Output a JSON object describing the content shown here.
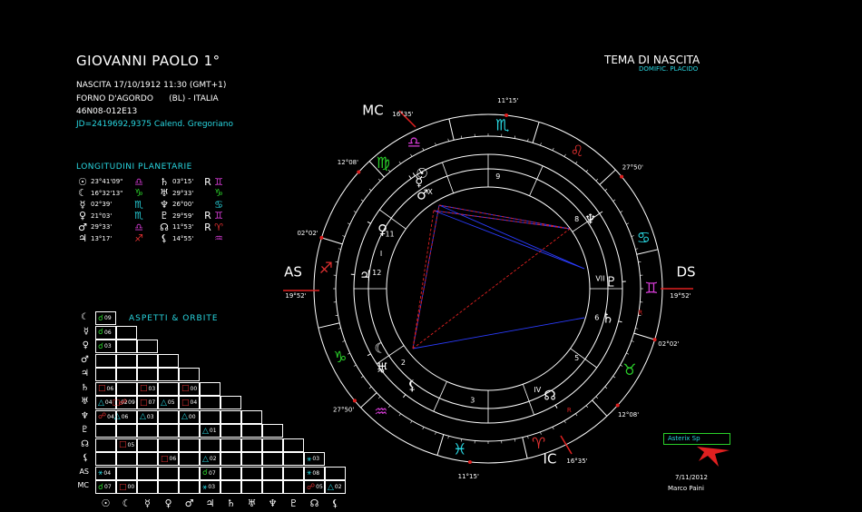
{
  "header": {
    "name": "GIOVANNI PAOLO 1°",
    "birth": "NASCITA 17/10/1912 11:30 (GMT+1)",
    "place": "FORNO D'AGORDO      (BL) - ITALIA",
    "coords": "46N08-012E13",
    "jd": "JD=2419692,9375  Calend. Gregoriano"
  },
  "chart_header": {
    "title": "TEMA DI NASCITA",
    "subtitle": "DOMIFIC. PLACIDO"
  },
  "longitudes": {
    "title": "LONGITUDINI PLANETARIE",
    "rows": [
      [
        {
          "g": "☉",
          "c": "#fff",
          "v": "23°41'09\""
        },
        {
          "g": "♎",
          "c": "#d43bd4",
          "v": ""
        },
        {
          "g": "♄",
          "c": "#fff",
          "v": "03°15'"
        },
        {
          "g": "R",
          "c": "#fff",
          "v": ""
        },
        {
          "g": "♊",
          "c": "#d43bd4",
          "v": ""
        }
      ],
      [
        {
          "g": "☾",
          "c": "#fff",
          "v": "16°32'13\""
        },
        {
          "g": "♑",
          "c": "#2ad02a",
          "v": ""
        },
        {
          "g": "♅",
          "c": "#fff",
          "v": "29°33'"
        },
        {
          "g": "",
          "c": "#fff",
          "v": ""
        },
        {
          "g": "♑",
          "c": "#2ad02a",
          "v": ""
        }
      ],
      [
        {
          "g": "☿",
          "c": "#fff",
          "v": "02°39'"
        },
        {
          "g": "♏",
          "c": "#29d6e0",
          "v": ""
        },
        {
          "g": "♆",
          "c": "#fff",
          "v": "26°00'"
        },
        {
          "g": "",
          "c": "#fff",
          "v": ""
        },
        {
          "g": "♋",
          "c": "#29d6e0",
          "v": ""
        }
      ],
      [
        {
          "g": "♀",
          "c": "#fff",
          "v": "21°03'"
        },
        {
          "g": "♏",
          "c": "#29d6e0",
          "v": ""
        },
        {
          "g": "♇",
          "c": "#fff",
          "v": "29°59'"
        },
        {
          "g": "R",
          "c": "#fff",
          "v": ""
        },
        {
          "g": "♊",
          "c": "#d43bd4",
          "v": ""
        }
      ],
      [
        {
          "g": "♂",
          "c": "#fff",
          "v": "29°33'"
        },
        {
          "g": "♎",
          "c": "#d43bd4",
          "v": ""
        },
        {
          "g": "☊",
          "c": "#fff",
          "v": "11°53'"
        },
        {
          "g": "R",
          "c": "#fff",
          "v": ""
        },
        {
          "g": "♈",
          "c": "#e03030",
          "v": ""
        }
      ],
      [
        {
          "g": "♃",
          "c": "#fff",
          "v": "13°17'"
        },
        {
          "g": "♐",
          "c": "#e03030",
          "v": ""
        },
        {
          "g": "⚸",
          "c": "#fff",
          "v": "14°55'"
        },
        {
          "g": "",
          "c": "#fff",
          "v": ""
        },
        {
          "g": "♒",
          "c": "#d43bd4",
          "v": ""
        }
      ]
    ]
  },
  "aspects": {
    "title": "ASPETTI  &  ORBITE",
    "row_labels": [
      "☾",
      "☿",
      "♀",
      "♂",
      "♃",
      "♄",
      "♅",
      "♆",
      "♇",
      "☊",
      "⚸",
      "AS",
      "MC"
    ],
    "col_labels": [
      "☉",
      "☾",
      "☿",
      "♀",
      "♂",
      "♃",
      "♄",
      "♅",
      "♆",
      "♇",
      "☊",
      "⚸"
    ],
    "cells": [
      {
        "r": 0,
        "c": 0,
        "s": "☌",
        "sc": "#2ad02a",
        "v": "09"
      },
      {
        "r": 1,
        "c": 0,
        "s": "☌",
        "sc": "#2ad02a",
        "v": "06"
      },
      {
        "r": 1,
        "c": 2,
        "s": "☌",
        "sc": "#2ad02a",
        "v": "03"
      },
      {
        "r": 5,
        "c": 0,
        "s": "□",
        "sc": "#e03030",
        "v": "06"
      },
      {
        "r": 5,
        "c": 2,
        "s": "□",
        "sc": "#e03030",
        "v": "03"
      },
      {
        "r": 5,
        "c": 4,
        "s": "□",
        "sc": "#e03030",
        "v": "00"
      },
      {
        "r": 5,
        "c": 6,
        "s": "△",
        "sc": "#29d6e0",
        "v": "04"
      },
      {
        "r": 6,
        "c": 0,
        "s": "□",
        "sc": "#e03030",
        "v": "02"
      },
      {
        "r": 6,
        "c": 1,
        "s": "☍",
        "sc": "#e03030",
        "v": "09"
      },
      {
        "r": 6,
        "c": 2,
        "s": "□",
        "sc": "#e03030",
        "v": "07"
      },
      {
        "r": 6,
        "c": 3,
        "s": "△",
        "sc": "#29d6e0",
        "v": "05"
      },
      {
        "r": 6,
        "c": 4,
        "s": "□",
        "sc": "#e03030",
        "v": "04"
      },
      {
        "r": 6,
        "c": 7,
        "s": "☍",
        "sc": "#e03030",
        "v": "04"
      },
      {
        "r": 7,
        "c": 0,
        "s": "△",
        "sc": "#29d6e0",
        "v": "06"
      },
      {
        "r": 7,
        "c": 2,
        "s": "△",
        "sc": "#29d6e0",
        "v": "03"
      },
      {
        "r": 7,
        "c": 4,
        "s": "△",
        "sc": "#29d6e0",
        "v": "00"
      },
      {
        "r": 8,
        "c": 5,
        "s": "△",
        "sc": "#29d6e0",
        "v": "01"
      },
      {
        "r": 9,
        "c": 1,
        "s": "□",
        "sc": "#e03030",
        "v": "05"
      },
      {
        "r": 10,
        "c": 3,
        "s": "□",
        "sc": "#e03030",
        "v": "06"
      },
      {
        "r": 10,
        "c": 5,
        "s": "△",
        "sc": "#29d6e0",
        "v": "02"
      },
      {
        "r": 10,
        "c": 10,
        "s": "⚹",
        "sc": "#29d6e0",
        "v": "03"
      },
      {
        "r": 11,
        "c": 0,
        "s": "⚹",
        "sc": "#29d6e0",
        "v": "04"
      },
      {
        "r": 11,
        "c": 5,
        "s": "☌",
        "sc": "#2ad02a",
        "v": "07"
      },
      {
        "r": 11,
        "c": 10,
        "s": "⚹",
        "sc": "#29d6e0",
        "v": "08"
      },
      {
        "r": 12,
        "c": 0,
        "s": "☌",
        "sc": "#2ad02a",
        "v": "07"
      },
      {
        "r": 12,
        "c": 1,
        "s": "□",
        "sc": "#e03030",
        "v": "00"
      },
      {
        "r": 12,
        "c": 5,
        "s": "⚹",
        "sc": "#29d6e0",
        "v": "03"
      },
      {
        "r": 12,
        "c": 10,
        "s": "☍",
        "sc": "#e03030",
        "v": "05"
      },
      {
        "r": 12,
        "c": 11,
        "s": "△",
        "sc": "#29d6e0",
        "v": "02"
      }
    ]
  },
  "wheel": {
    "angles": {
      "mc": {
        "label": "MC",
        "deg": "16°35'"
      },
      "as": {
        "label": "AS",
        "deg": "19°52'"
      },
      "ds": {
        "label": "DS",
        "deg": "19°52'"
      },
      "ic": {
        "label": "IC",
        "deg": "16°35'"
      }
    },
    "cusp_degrees": [
      {
        "t": "11°15'",
        "a": -84
      },
      {
        "t": "27°50'",
        "a": -40
      },
      {
        "t": "02°02'",
        "a": 17
      },
      {
        "t": "12°08'",
        "a": 42
      },
      {
        "t": "11°15'",
        "a": 96
      },
      {
        "t": "27°50'",
        "a": 140
      },
      {
        "t": "02°02'",
        "a": 197
      },
      {
        "t": "12°08'",
        "a": 222
      }
    ],
    "signs": [
      {
        "g": "♎",
        "c": "#d43bd4",
        "a": -117
      },
      {
        "g": "♏",
        "c": "#29d6e0",
        "a": -85
      },
      {
        "g": "♌",
        "c": "#e03030",
        "a": -57
      },
      {
        "g": "♋",
        "c": "#29d6e0",
        "a": -18
      },
      {
        "g": "♊",
        "c": "#d43bd4",
        "a": 0
      },
      {
        "g": "♉",
        "c": "#2ad02a",
        "a": 30
      },
      {
        "g": "♈",
        "c": "#e03030",
        "a": 72
      },
      {
        "g": "♓",
        "c": "#29d6e0",
        "a": 100
      },
      {
        "g": "♒",
        "c": "#d43bd4",
        "a": 131
      },
      {
        "g": "♑",
        "c": "#2ad02a",
        "a": 155
      },
      {
        "g": "♐",
        "c": "#e03030",
        "a": 187
      },
      {
        "g": "♍",
        "c": "#2ad02a",
        "a": 230
      }
    ],
    "houses": [
      {
        "t": "I",
        "a": 198
      },
      {
        "t": "2",
        "a": 139
      },
      {
        "t": "3",
        "a": 98
      },
      {
        "t": "IV",
        "a": 64
      },
      {
        "t": "5",
        "a": 38
      },
      {
        "t": "6",
        "a": 15
      },
      {
        "t": "VII",
        "a": -5
      },
      {
        "t": "8",
        "a": -38
      },
      {
        "t": "9",
        "a": -85
      },
      {
        "t": "X",
        "a": -121
      },
      {
        "t": "11",
        "a": -151
      },
      {
        "t": "12",
        "a": 188
      }
    ],
    "planets": [
      {
        "g": "☉",
        "a": -120,
        "r": 138
      },
      {
        "g": "☿",
        "a": -123,
        "r": 132
      },
      {
        "g": "♀",
        "a": -151,
        "r": 125
      },
      {
        "g": "♂",
        "a": -125,
        "r": 118
      },
      {
        "g": "♃",
        "a": 186,
        "r": 128
      },
      {
        "g": "☾",
        "a": 151,
        "r": 128
      },
      {
        "g": "♅",
        "a": 143,
        "r": 138
      },
      {
        "g": "⚸",
        "a": 128,
        "r": 128
      },
      {
        "g": "♄",
        "a": 14,
        "r": 128
      },
      {
        "g": "♇",
        "a": -3,
        "r": 128
      },
      {
        "g": "♆",
        "a": -34,
        "r": 128
      },
      {
        "g": "☊",
        "a": 60,
        "r": 128
      }
    ],
    "retro": [
      {
        "t": "R",
        "a": 10
      },
      {
        "t": "R",
        "a": 62
      }
    ]
  },
  "badge": "Asterix Sp",
  "footer": {
    "date": "7/11/2012",
    "author": "Marco Paini"
  }
}
